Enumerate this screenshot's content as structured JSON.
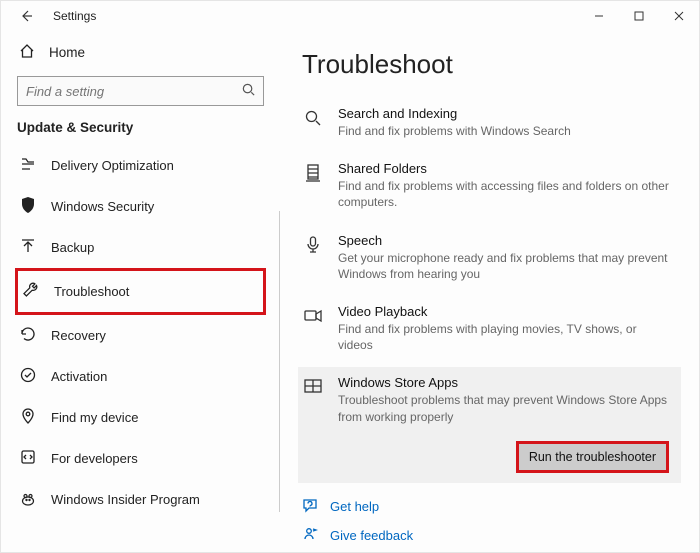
{
  "window": {
    "title": "Settings"
  },
  "sidebar": {
    "home": "Home",
    "search_placeholder": "Find a setting",
    "section": "Update & Security",
    "items": [
      "Delivery Optimization",
      "Windows Security",
      "Backup",
      "Troubleshoot",
      "Recovery",
      "Activation",
      "Find my device",
      "For developers",
      "Windows Insider Program"
    ],
    "selected_index": 3
  },
  "main": {
    "heading": "Troubleshoot",
    "items": [
      {
        "title": "Search and Indexing",
        "desc": "Find and fix problems with Windows Search"
      },
      {
        "title": "Shared Folders",
        "desc": "Find and fix problems with accessing files and folders on other computers."
      },
      {
        "title": "Speech",
        "desc": "Get your microphone ready and fix problems that may prevent Windows from hearing you"
      },
      {
        "title": "Video Playback",
        "desc": "Find and fix problems with playing movies, TV shows, or videos"
      },
      {
        "title": "Windows Store Apps",
        "desc": "Troubleshoot problems that may prevent Windows Store Apps from working properly"
      }
    ],
    "selected_index": 4,
    "run_button": "Run the troubleshooter",
    "help": "Get help",
    "feedback": "Give feedback"
  }
}
